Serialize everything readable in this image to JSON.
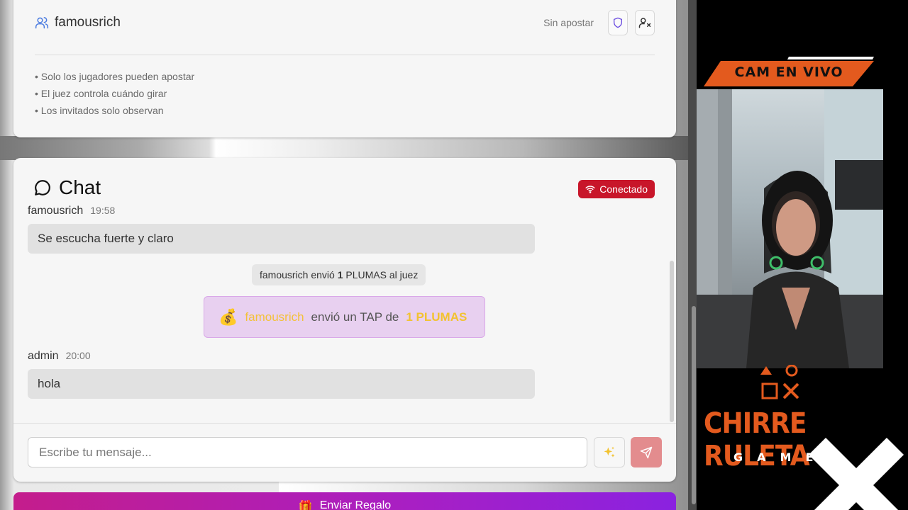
{
  "players_panel": {
    "player_name": "famousrich",
    "player_status": "Sin apostar",
    "rules": [
      "Solo los jugadores pueden apostar",
      "El juez controla cuándo girar",
      "Los invitados solo observan"
    ]
  },
  "chat": {
    "title": "Chat",
    "status": "Conectado",
    "messages": [
      {
        "user": "famousrich",
        "time": "19:58",
        "text": "Se escucha fuerte y claro"
      },
      {
        "user": "admin",
        "time": "20:00",
        "text": "hola"
      }
    ],
    "system_message": {
      "user": "famousrich",
      "middle": " envió ",
      "amount": "1",
      "rest": " PLUMAS al juez"
    },
    "tap_message": {
      "icon": "money-bag",
      "sender": "famousrich",
      "middle": "envió un TAP de",
      "amount": "1 PLUMAS"
    },
    "input_placeholder": "Escribe tu mensaje..."
  },
  "bottom_button": {
    "label": "Enviar Regalo"
  },
  "stream_overlay": {
    "cam_label": "CAM EN VIVO",
    "brand_title": "CHIRRE RULETA",
    "brand_sub": "GAMES"
  },
  "colors": {
    "connected_badge": "#c8162a",
    "send_button": "#e38c8e",
    "tap_background": "#e8d0f0",
    "tap_highlight": "#f2c230",
    "brand_orange": "#e35a1e"
  }
}
